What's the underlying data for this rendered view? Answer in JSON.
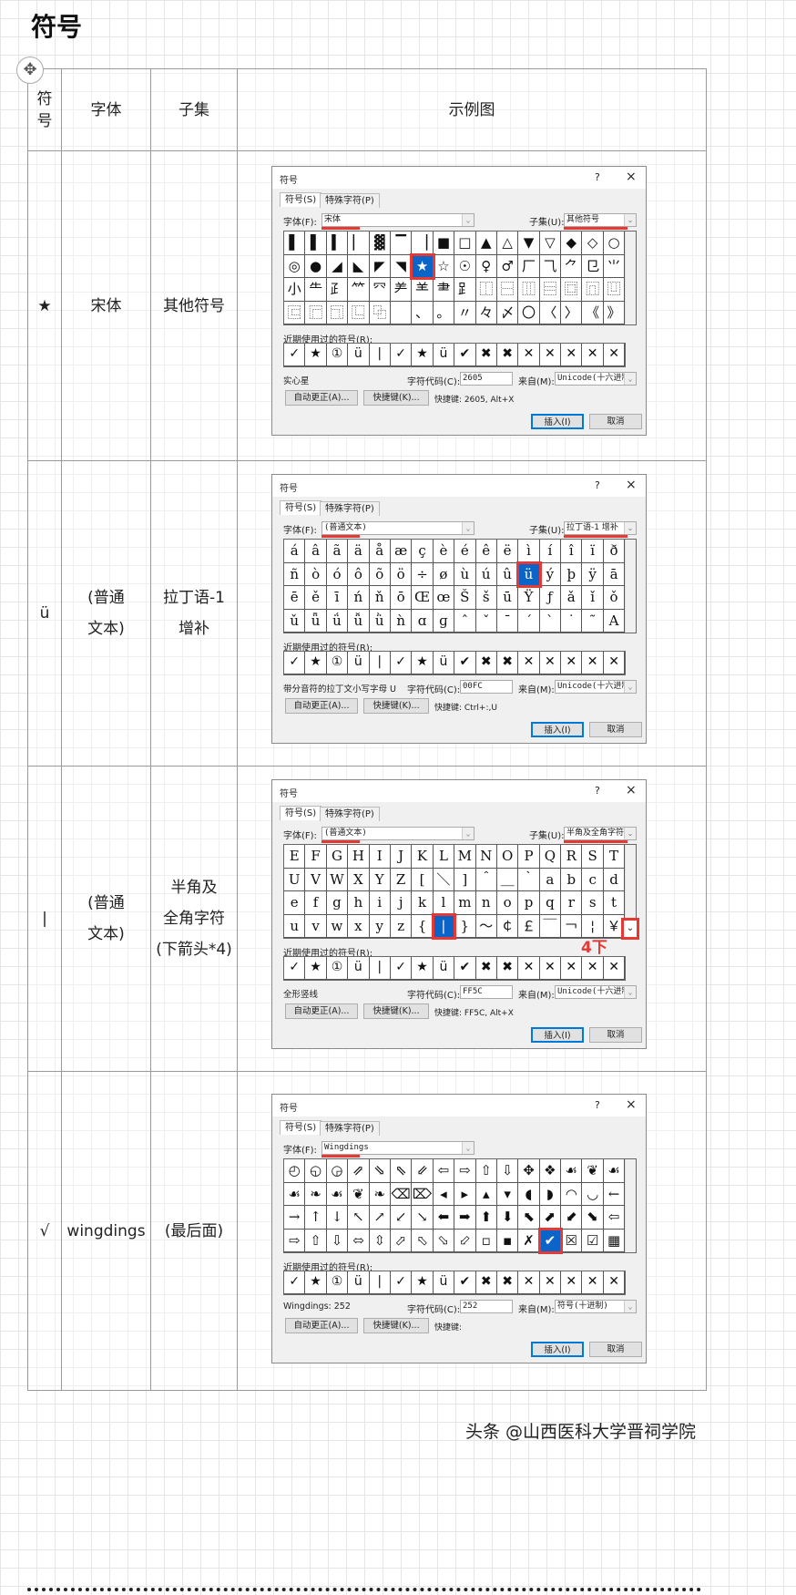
{
  "page_title": "符号",
  "table": {
    "headers": [
      "符\n号",
      "字体",
      "子集",
      "示例图"
    ],
    "rows": [
      {
        "symbol": "★",
        "font": "宋体",
        "subset": "其他符号"
      },
      {
        "symbol": "ü",
        "font": "(普通\n文本)",
        "subset": "拉丁语-1\n增补"
      },
      {
        "symbol": "|",
        "font": "(普通\n文本)",
        "subset": "半角及\n全角字符\n(下箭头*4)"
      },
      {
        "symbol": "√",
        "font": "wingdings",
        "subset": "(最后面)"
      }
    ]
  },
  "dialog_common": {
    "title": "符号",
    "help": "?",
    "close": "×",
    "tab_symbols": "符号(S)",
    "tab_special": "特殊字符(P)",
    "font_label": "字体(F):",
    "subset_label": "子集(U):",
    "recent_label": "近期使用过的符号(R):",
    "recent": [
      "✓",
      "★",
      "①",
      "ü",
      "|",
      "✓",
      "★",
      "ü",
      "✔",
      "✖",
      "✖",
      "✕",
      "✕",
      "✕",
      "✕",
      "✕"
    ],
    "code_label": "字符代码(C):",
    "from_label": "来自(M):",
    "autocorrect": "自动更正(A)...",
    "shortcut_key": "快捷键(K)...",
    "insert": "插入(I)",
    "cancel": "取消"
  },
  "dialogs": [
    {
      "font": "宋体",
      "subset": "其他符号",
      "selected": 22,
      "chars": [
        "▌",
        "▌",
        "▍",
        "▏",
        "▓",
        "▔",
        "▕",
        "■",
        "□",
        "▲",
        "△",
        "▼",
        "▽",
        "◆",
        "◇",
        "○",
        "◎",
        "●",
        "◢",
        "◣",
        "◤",
        "◥",
        "★",
        "☆",
        "☉",
        "♀",
        "♂",
        "厂",
        "⺄",
        "⺈",
        "㔾",
        "⺌",
        "小",
        "⺧",
        "⺪",
        "⺮",
        "⺳",
        "⺶",
        "⺷",
        "⺻",
        "⻊",
        "⿰",
        "⿱",
        "⿲",
        "⿳",
        "⿴",
        "⿵",
        "⿶",
        "⿷",
        "⿸",
        "⿹",
        "⿺",
        "⿻",
        "",
        "、",
        "。",
        "〃",
        "々",
        "〆",
        "〇",
        "〈",
        "〉",
        "《",
        "》"
      ],
      "desc": "实心星",
      "code": "2605",
      "from": "Unicode(十六进制)",
      "shortcut": "快捷键: 2605, Alt+X"
    },
    {
      "font": "(普通文本)",
      "subset": "拉丁语-1 增补",
      "selected": 27,
      "chars": [
        "á",
        "â",
        "ã",
        "ä",
        "å",
        "æ",
        "ç",
        "è",
        "é",
        "ê",
        "ë",
        "ì",
        "í",
        "î",
        "ï",
        "ð",
        "ñ",
        "ò",
        "ó",
        "ô",
        "õ",
        "ö",
        "÷",
        "ø",
        "ù",
        "ú",
        "û",
        "ü",
        "ý",
        "þ",
        "ÿ",
        "ā",
        "ē",
        "ě",
        "ī",
        "ń",
        "ň",
        "ō",
        "Œ",
        "œ",
        "Š",
        "š",
        "ū",
        "Ÿ",
        "ƒ",
        "ǎ",
        "ǐ",
        "ǒ",
        "ǔ",
        "ǖ",
        "ǘ",
        "ǚ",
        "ǜ",
        "ǹ",
        "ɑ",
        "ɡ",
        "ˆ",
        "ˇ",
        "ˉ",
        "ˊ",
        "ˋ",
        "˙",
        "˜",
        "Α"
      ],
      "desc": "带分音符的拉丁文小写字母 U",
      "code": "00FC",
      "from": "Unicode(十六进制)",
      "shortcut": "快捷键: Ctrl+:,U"
    },
    {
      "font": "(普通文本)",
      "subset": "半角及全角字符",
      "selected": 55,
      "chars": [
        "E",
        "F",
        "G",
        "H",
        "I",
        "J",
        "K",
        "L",
        "M",
        "N",
        "O",
        "P",
        "Q",
        "R",
        "S",
        "T",
        "U",
        "V",
        "W",
        "X",
        "Y",
        "Z",
        "[",
        "＼",
        "]",
        "＾",
        "＿",
        "｀",
        "a",
        "b",
        "c",
        "d",
        "e",
        "f",
        "g",
        "h",
        "i",
        "j",
        "k",
        "l",
        "m",
        "n",
        "o",
        "p",
        "q",
        "r",
        "s",
        "t",
        "u",
        "v",
        "w",
        "x",
        "y",
        "z",
        "{",
        "|",
        "}",
        "～",
        "￠",
        "￡",
        "￣",
        "￢",
        "¦",
        "￥"
      ],
      "desc": "全形竖线",
      "code": "FF5C",
      "from": "Unicode(十六进制)",
      "shortcut": "快捷键: FF5C, Alt+X",
      "annotation": "4下"
    },
    {
      "font": "Wingdings",
      "subset": null,
      "selected": 60,
      "chars": [
        "◴",
        "◵",
        "◶",
        "⇗",
        "⇘",
        "⇖",
        "⇙",
        "⇦",
        "⇨",
        "⇧",
        "⇩",
        "✥",
        "❖",
        "☙",
        "❦",
        "☙",
        "☙",
        "❧",
        "☙",
        "❦",
        "❧",
        "⌫",
        "⌦",
        "◂",
        "▸",
        "▴",
        "▾",
        "◖",
        "◗",
        "◠",
        "◡",
        "←",
        "→",
        "↑",
        "↓",
        "↖",
        "↗",
        "↙",
        "↘",
        "⬅",
        "➡",
        "⬆",
        "⬇",
        "⬉",
        "⬈",
        "⬋",
        "⬊",
        "⇦",
        "⇨",
        "⇧",
        "⇩",
        "⬄",
        "⇳",
        "⬀",
        "⬁",
        "⬂",
        "⬃",
        "▫",
        "▪",
        "✗",
        "✔",
        "☒",
        "☑",
        "▦"
      ],
      "desc": "Wingdings: 252",
      "code": "252",
      "from": "符号(十进制)",
      "shortcut": "快捷键:"
    }
  ],
  "footer": "头条 @山西医科大学晋祠学院"
}
